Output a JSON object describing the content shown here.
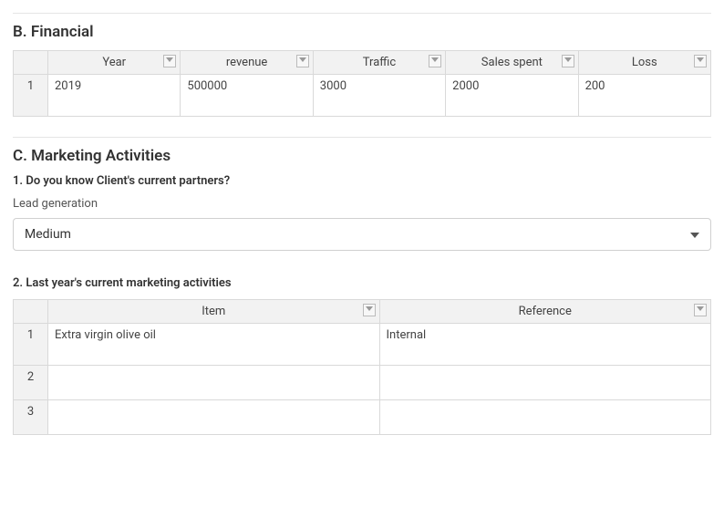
{
  "sectionB": {
    "title": "B. Financial",
    "headers": [
      "Year",
      "revenue",
      "Traffic",
      "Sales spent",
      "Loss"
    ],
    "rows": [
      {
        "num": "1",
        "cells": [
          "2019",
          "500000",
          "3000",
          "2000",
          "200"
        ]
      }
    ]
  },
  "sectionC": {
    "title": "C. Marketing Activities",
    "q1": "1. Do you know Client's current partners?",
    "q1_label": "Lead generation",
    "q1_selected": "Medium",
    "q2": "2. Last year's current marketing activities",
    "q2_headers": [
      "Item",
      "Reference"
    ],
    "q2_rows": [
      {
        "num": "1",
        "cells": [
          "Extra virgin olive oil",
          "Internal"
        ]
      },
      {
        "num": "2",
        "cells": [
          "",
          ""
        ]
      },
      {
        "num": "3",
        "cells": [
          "",
          ""
        ]
      }
    ]
  }
}
